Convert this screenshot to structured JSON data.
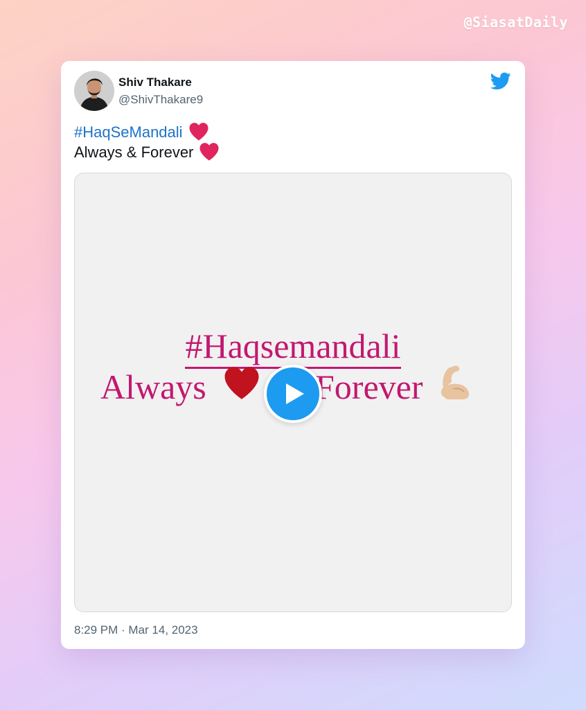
{
  "watermark": "@SiasatDaily",
  "tweet": {
    "author": {
      "name": "Shiv Thakare",
      "handle": "@ShivThakare9"
    },
    "text": {
      "hashtag": "#HaqSeMandali",
      "line2": "Always & Forever"
    },
    "media": {
      "type": "video",
      "overlay_hashtag": "#Haqsemandali",
      "overlay_word1": "Always",
      "overlay_word2": "Forever"
    },
    "timestamp": "8:29 PM · Mar 14, 2023"
  },
  "icons": {
    "brand": "twitter-bird-icon",
    "emoji_heart": "red-heart-icon",
    "emoji_muscle": "flexed-biceps-icon",
    "play": "play-icon"
  },
  "colors": {
    "twitter_blue": "#1d9bf0",
    "hashtag_link": "#1d73c8",
    "video_text": "#c2186f",
    "heart_red": "#e0245e"
  }
}
